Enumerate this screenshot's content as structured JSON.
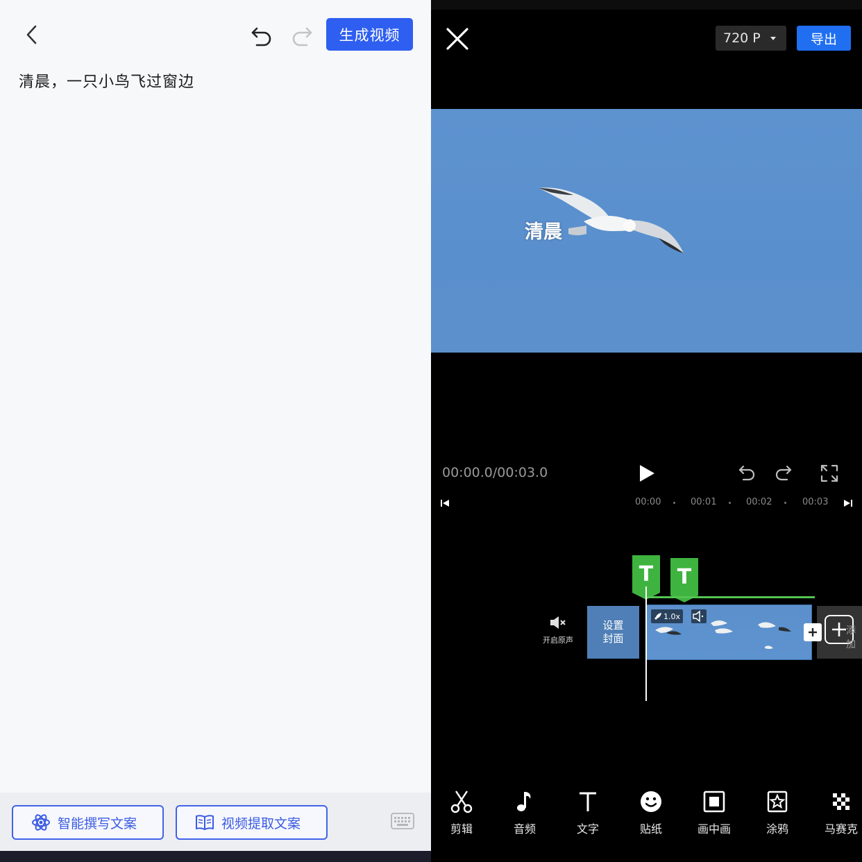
{
  "editor": {
    "generate_label": "生成视频",
    "script_text": "清晨，一只小鸟飞过窗边",
    "ai_write_label": "智能撰写文案",
    "extract_label": "视频提取文案"
  },
  "player": {
    "resolution": "720 P",
    "export_label": "导出",
    "caption": "清晨",
    "timecode": "00:00.0/00:03.0",
    "ruler_ticks": [
      "00:00",
      "00:01",
      "00:02",
      "00:03"
    ],
    "text_marker": "T"
  },
  "timeline": {
    "mute_label": "开启原声",
    "cover_label_1": "设置",
    "cover_label_2": "封面",
    "speed": "1.0x",
    "add_label": "添加"
  },
  "toolbar": {
    "items": [
      {
        "label": "剪辑",
        "icon": "scissors-icon"
      },
      {
        "label": "音频",
        "icon": "music-note-icon"
      },
      {
        "label": "文字",
        "icon": "text-icon"
      },
      {
        "label": "贴纸",
        "icon": "sticker-icon"
      },
      {
        "label": "画中画",
        "icon": "pip-icon"
      },
      {
        "label": "涂鸦",
        "icon": "doodle-icon"
      },
      {
        "label": "马赛克",
        "icon": "mosaic-icon"
      }
    ]
  },
  "colors": {
    "primary": "#2f5ff0",
    "export": "#1f6ff0",
    "marker_green": "#3fb33f"
  }
}
